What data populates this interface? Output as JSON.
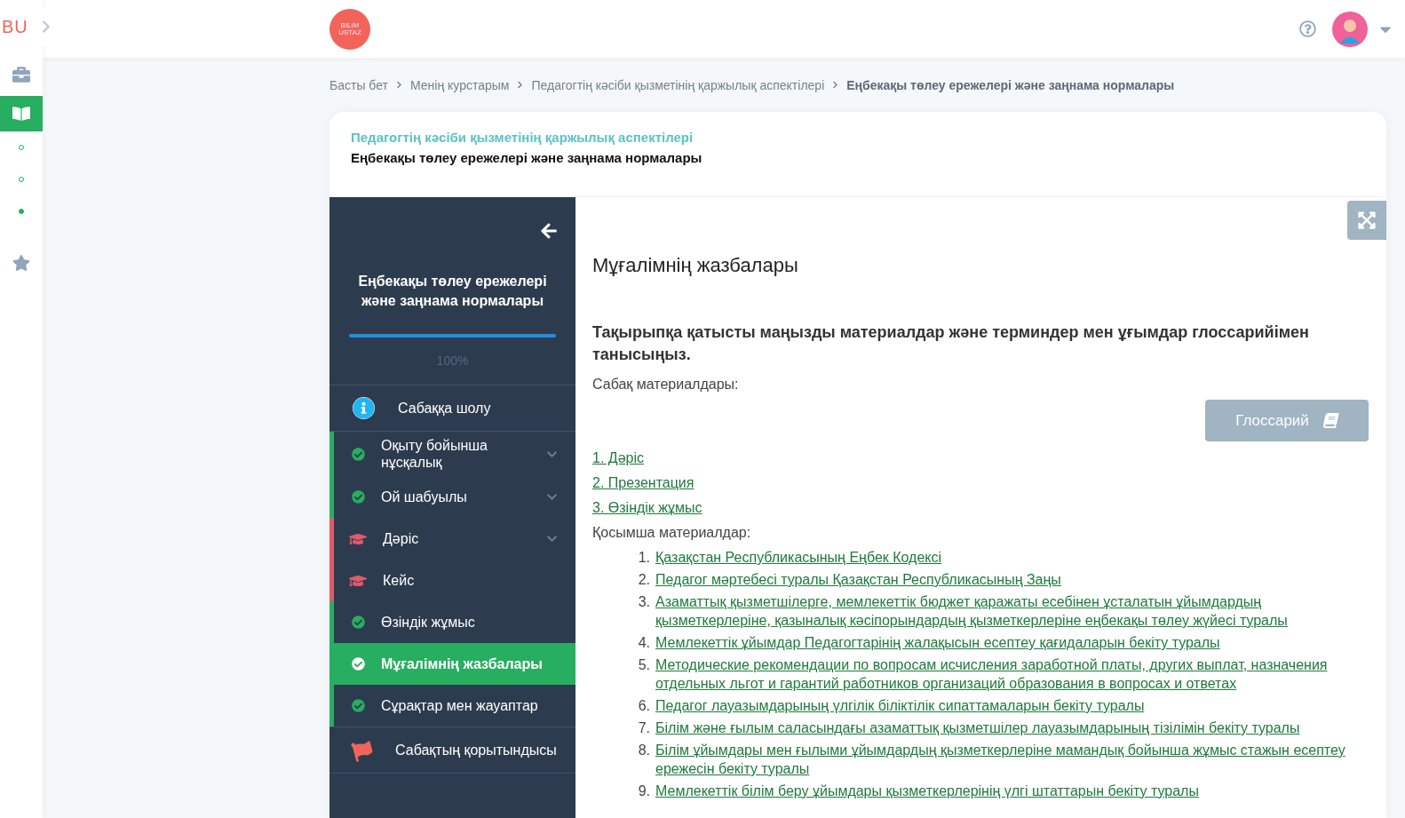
{
  "rail": {
    "logo": "BU",
    "items": [
      {
        "kind": "briefcase",
        "selected": false
      },
      {
        "kind": "book",
        "selected": true
      },
      {
        "kind": "dot",
        "filled": false
      },
      {
        "kind": "dot",
        "filled": false
      },
      {
        "kind": "dot",
        "filled": true
      },
      {
        "kind": "star",
        "selected": false
      }
    ]
  },
  "topbar": {
    "logo_lines": [
      "BILIM",
      "USTAZ"
    ]
  },
  "breadcrumb": [
    {
      "label": "Басты бет",
      "current": false
    },
    {
      "label": "Менің курстарым",
      "current": false
    },
    {
      "label": "Педагогтің кәсіби қызметінің қаржылық аспектілері",
      "current": false
    },
    {
      "label": "Еңбекақы төлеу ережелері және заңнама нормалары",
      "current": true
    }
  ],
  "card": {
    "course": "Педагогтің кәсіби қызметінің қаржылық аспектілері",
    "lesson": "Еңбекақы төлеу ережелері және заңнама нормалары"
  },
  "sidebar": {
    "title": "Еңбекақы төлеу ережелері және заңнама нормалары",
    "progress": {
      "level": 1.0,
      "reading": "100%"
    },
    "items": [
      {
        "kind": "info",
        "label": "Сабаққа шолу",
        "selected": false
      },
      {
        "kind": "step",
        "done": true,
        "label": "Оқыту бойынша нұсқалық",
        "expandable": true,
        "selected": false
      },
      {
        "kind": "step",
        "done": true,
        "label": "Ой шабуылы",
        "expandable": true,
        "selected": false
      },
      {
        "kind": "step",
        "done": false,
        "label": "Дәріс",
        "expandable": true,
        "selected": false
      },
      {
        "kind": "step",
        "done": false,
        "label": "Кейс",
        "expandable": false,
        "selected": false
      },
      {
        "kind": "step",
        "done": true,
        "label": "Өзіндік жұмыс",
        "expandable": false,
        "selected": false
      },
      {
        "kind": "step",
        "done": true,
        "label": "Мұғалімнің жазбалары",
        "expandable": false,
        "selected": true
      },
      {
        "kind": "step",
        "done": true,
        "label": "Сұрақтар мен жауаптар",
        "expandable": false,
        "selected": false
      },
      {
        "kind": "flag",
        "label": "Сабақтың қорытындысы",
        "selected": false
      }
    ]
  },
  "content": {
    "heading": "Мұғалімнің жазбалары",
    "intro": "Тақырыпқа қатысты маңызды материалдар және терминдер мен ұғымдар глоссарийімен танысыңыз.",
    "materials_label": "Сабақ материалдары:",
    "glossary_button": "Глоссарий",
    "materials": [
      "1. Дәріс",
      "2. Презентация",
      "3. Өзіндік жұмыс"
    ],
    "extra_label": "Қосымша материалдар:",
    "extra": [
      {
        "number": "1.",
        "text": "Қазақстан Республикасының Еңбек Кодексі"
      },
      {
        "number": "2.",
        "text": "Педагог мәртебесі туралы Қазақстан Республикасының Заңы"
      },
      {
        "number": "3.",
        "text": "Азаматтық қызметшілерге, мемлекеттік бюджет қаражаты есебінен ұсталатын ұйымдардың қызметкерлеріне, қазыналық кәсіпорындардың қызметкерлеріне еңбекақы төлеу жүйесі туралы"
      },
      {
        "number": "4.",
        "text": "Мемлекеттік ұйымдар Педагогтарінің жалақысын есептеу қағидаларын бекіту туралы"
      },
      {
        "number": "5.",
        "text": "Методические рекомендации по вопросам исчисления заработной платы, других выплат, назначения отдельных льгот и гарантий работников организаций образования в вопросах и ответах"
      },
      {
        "number": "6.",
        "text": "Педагог лауазымдарының үлгілік біліктілік сипаттамаларын бекіту туралы"
      },
      {
        "number": "7.",
        "text": "Білім және ғылым саласындағы азаматтық қызметшілер лауазымдарының тізілімін бекіту туралы"
      },
      {
        "number": "8.",
        "text": "Білім ұйымдары мен ғылыми ұйымдардың қызметкерлеріне мамандық бойынша жұмыс стажын есептеу ережесін бекіту туралы"
      },
      {
        "number": "9.",
        "text": "Мемлекеттік білім беру ұйымдары қызметкерлерінің үлгі штаттарын бекіту туралы"
      }
    ]
  }
}
